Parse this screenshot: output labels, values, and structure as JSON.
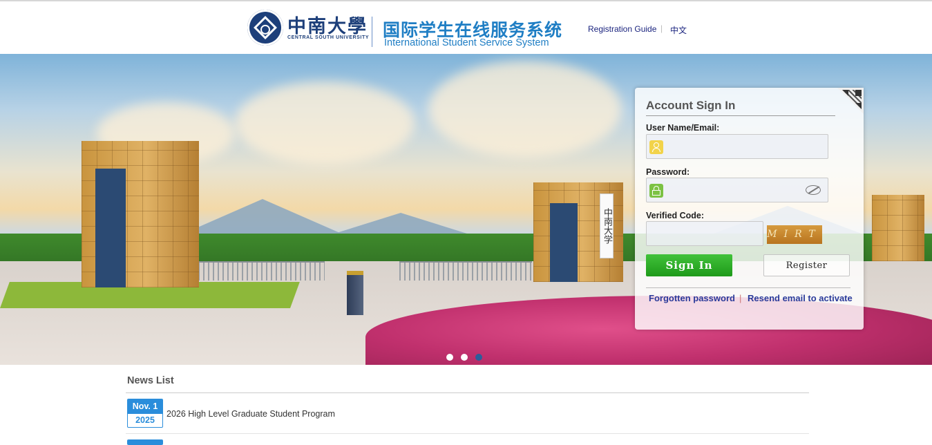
{
  "header": {
    "university_cn": "中南大學",
    "university_en": "CENTRAL SOUTH UNIVERSITY",
    "system_cn": "国际学生在线服务系统",
    "system_en": "International Student Service System",
    "registration_guide": "Registration Guide",
    "separator": "|",
    "lang_switch": "中文"
  },
  "banner": {
    "gate_sign": "中南大学",
    "slides_count": 3,
    "active_slide": 3
  },
  "login": {
    "title": "Account Sign In",
    "username_label": "User Name/Email:",
    "username_value": "",
    "password_label": "Password:",
    "password_value": "",
    "verified_code_label": "Verified Code:",
    "verified_code_value": "",
    "captcha_text": "MIRT",
    "sign_in": "Sign In",
    "register": "Register",
    "forgot_password": "Forgotten password",
    "link_separator": "|",
    "resend_email": "Resend email to activate"
  },
  "news": {
    "title": "News List",
    "items": [
      {
        "month_day": "Nov. 1",
        "year": "2025",
        "text": "2026 High Level Graduate Student Program"
      }
    ]
  },
  "colors": {
    "brand_blue": "#1f7ec4",
    "seal_navy": "#1d3f7a",
    "sign_in_green": "#1e9a1a",
    "date_blue": "#2a8ddb"
  }
}
